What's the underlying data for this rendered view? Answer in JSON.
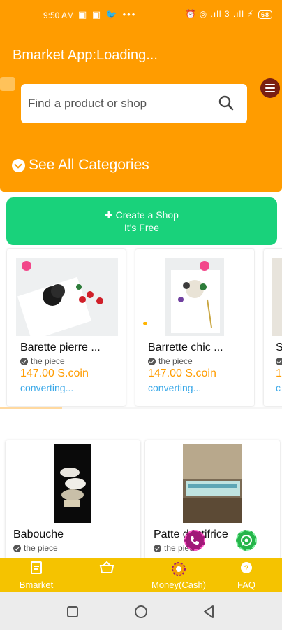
{
  "status_bar": {
    "time": "9:50 AM",
    "left_icons": "▣ ▣ 🐦 •••",
    "right_icons": "⏰ ◎ .ıll 3 .ıll ⚡",
    "battery": "68"
  },
  "app": {
    "title": "Bmarket App:Loading..."
  },
  "search": {
    "placeholder": "Find a product or shop"
  },
  "categories": {
    "label": "See All Categories"
  },
  "create_shop": {
    "line1": "Create a Shop",
    "line2": "It's Free"
  },
  "featured_products": [
    {
      "name": "Barette pierre ...",
      "unit": "the piece",
      "price": "147.00 S.coin",
      "converting": "converting..."
    },
    {
      "name": "Barrette chic ...",
      "unit": "the piece",
      "price": "147.00 S.coin",
      "converting": "converting..."
    },
    {
      "name": "S",
      "unit": "t",
      "price": "1",
      "converting": "c"
    }
  ],
  "products": [
    {
      "name": "Babouche",
      "unit": "the piece"
    },
    {
      "name": "Patte dentifrice",
      "unit": "the piece"
    }
  ],
  "carousel_progress": 0.22,
  "bottom_nav": [
    {
      "label": "Bmarket",
      "icon": "document-icon"
    },
    {
      "label": "",
      "icon": "basket-icon"
    },
    {
      "label": "Money(Cash)",
      "icon": "coin-icon"
    },
    {
      "label": "FAQ",
      "icon": "question-icon"
    }
  ],
  "colors": {
    "primary": "#ff9c00",
    "green": "#19d27b",
    "nav": "#f5c300",
    "link": "#3aa8e8"
  }
}
